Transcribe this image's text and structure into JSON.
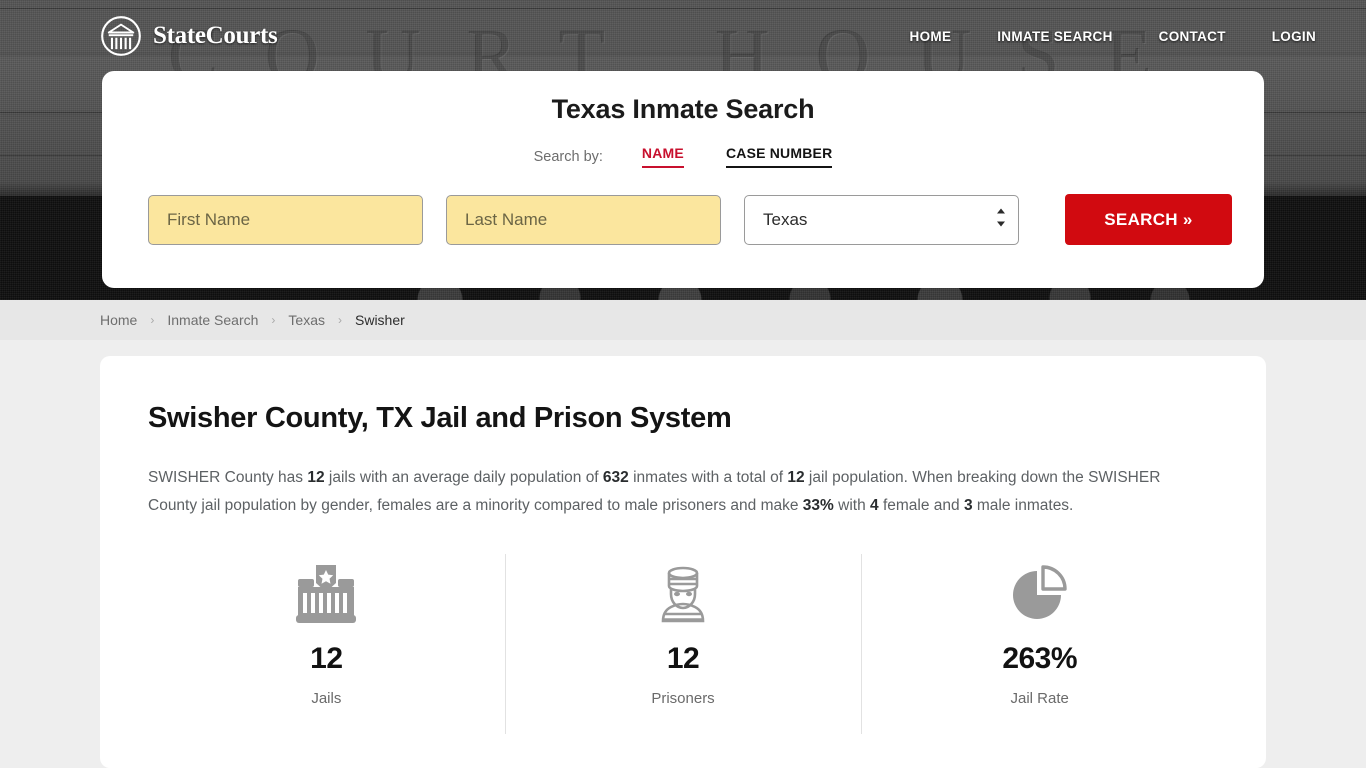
{
  "header": {
    "brand_name": "StateCourts",
    "brand_icon": "courthouse-circle-logo",
    "nav": [
      {
        "label": "HOME"
      },
      {
        "label": "INMATE SEARCH"
      },
      {
        "label": "CONTACT"
      },
      {
        "label": "LOGIN"
      }
    ]
  },
  "hero": {
    "background_letters": "COURT HOUSE",
    "background_color": "#4a4a4a"
  },
  "search_card": {
    "title": "Texas Inmate Search",
    "search_by_label": "Search by:",
    "tabs": [
      {
        "label": "NAME",
        "active": true,
        "color": "#c8102e"
      },
      {
        "label": "CASE NUMBER",
        "active": false,
        "color": "#141414"
      }
    ],
    "first_name": {
      "value": "",
      "placeholder": "First Name"
    },
    "last_name": {
      "value": "",
      "placeholder": "Last Name"
    },
    "state_select": {
      "value": "Texas",
      "options": [
        "Texas"
      ],
      "icon": "stepper-chevrons-icon"
    },
    "search_button": {
      "label": "SEARCH",
      "icon": "double-chevron-right-icon",
      "color": "#d10a10"
    }
  },
  "breadcrumb": {
    "separator": "›",
    "items": [
      {
        "label": "Home",
        "active": false
      },
      {
        "label": "Inmate Search",
        "active": false
      },
      {
        "label": "Texas",
        "active": false
      },
      {
        "label": "Swisher",
        "active": true
      }
    ]
  },
  "main": {
    "page_title": "Swisher County, TX Jail and Prison System",
    "summary": {
      "p1": "SWISHER County has ",
      "b1": "12",
      "p2": " jails with an average daily population of ",
      "b2": "632",
      "p3": " inmates with a total of ",
      "b3": "12",
      "p4": " jail population. When breaking down the SWISHER County jail population by gender, females are a minority compared to male prisoners and make ",
      "b4": "33%",
      "p5": " with ",
      "b5": "4",
      "p6": " female and ",
      "b6": "3",
      "p7": " male inmates."
    },
    "stats": [
      {
        "icon": "jail-building-icon",
        "value": "12",
        "label": "Jails"
      },
      {
        "icon": "prisoner-icon",
        "value": "12",
        "label": "Prisoners"
      },
      {
        "icon": "pie-chart-icon",
        "value": "263%",
        "label": "Jail Rate"
      }
    ]
  }
}
